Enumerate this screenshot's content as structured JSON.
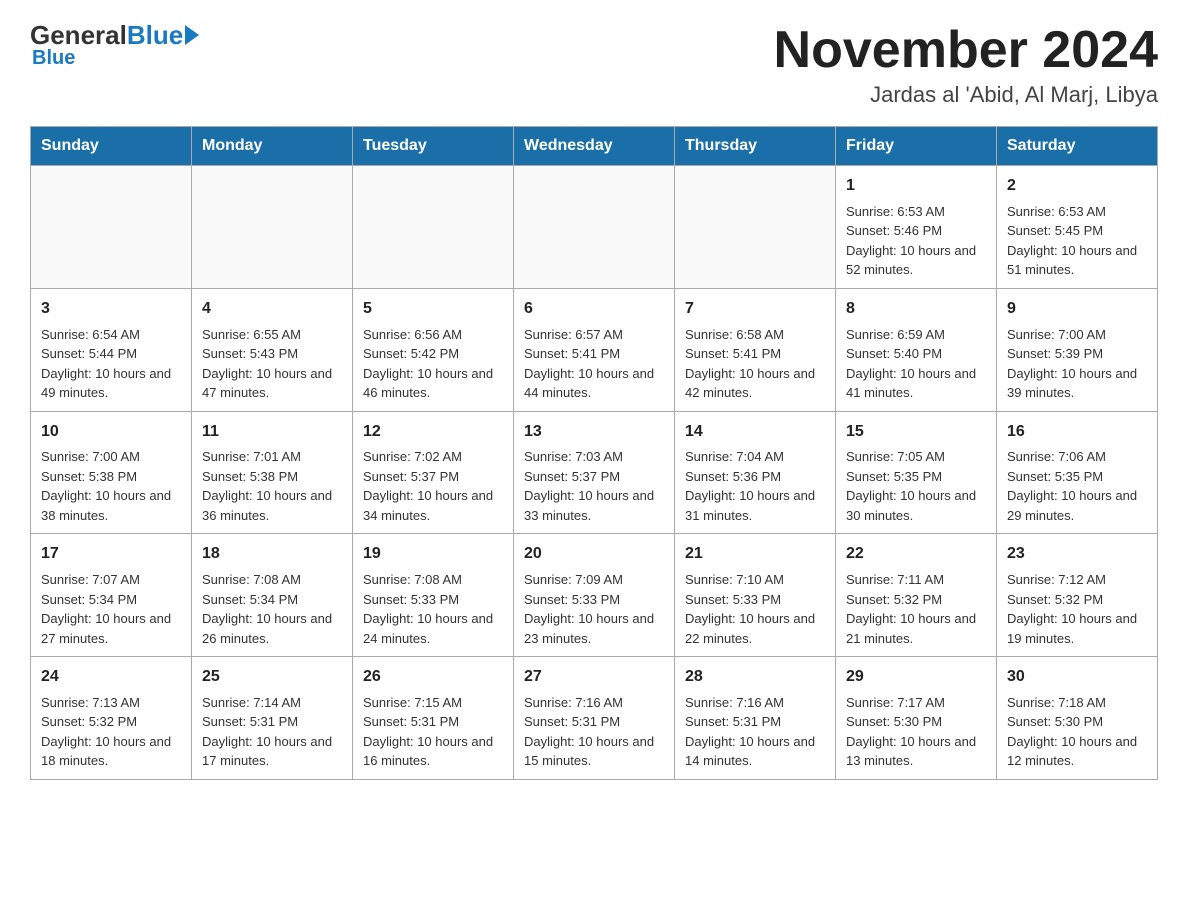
{
  "header": {
    "logo_general": "General",
    "logo_blue": "Blue",
    "month_title": "November 2024",
    "location": "Jardas al 'Abid, Al Marj, Libya"
  },
  "weekdays": [
    "Sunday",
    "Monday",
    "Tuesday",
    "Wednesday",
    "Thursday",
    "Friday",
    "Saturday"
  ],
  "weeks": [
    [
      {
        "day": "",
        "info": ""
      },
      {
        "day": "",
        "info": ""
      },
      {
        "day": "",
        "info": ""
      },
      {
        "day": "",
        "info": ""
      },
      {
        "day": "",
        "info": ""
      },
      {
        "day": "1",
        "info": "Sunrise: 6:53 AM\nSunset: 5:46 PM\nDaylight: 10 hours and 52 minutes."
      },
      {
        "day": "2",
        "info": "Sunrise: 6:53 AM\nSunset: 5:45 PM\nDaylight: 10 hours and 51 minutes."
      }
    ],
    [
      {
        "day": "3",
        "info": "Sunrise: 6:54 AM\nSunset: 5:44 PM\nDaylight: 10 hours and 49 minutes."
      },
      {
        "day": "4",
        "info": "Sunrise: 6:55 AM\nSunset: 5:43 PM\nDaylight: 10 hours and 47 minutes."
      },
      {
        "day": "5",
        "info": "Sunrise: 6:56 AM\nSunset: 5:42 PM\nDaylight: 10 hours and 46 minutes."
      },
      {
        "day": "6",
        "info": "Sunrise: 6:57 AM\nSunset: 5:41 PM\nDaylight: 10 hours and 44 minutes."
      },
      {
        "day": "7",
        "info": "Sunrise: 6:58 AM\nSunset: 5:41 PM\nDaylight: 10 hours and 42 minutes."
      },
      {
        "day": "8",
        "info": "Sunrise: 6:59 AM\nSunset: 5:40 PM\nDaylight: 10 hours and 41 minutes."
      },
      {
        "day": "9",
        "info": "Sunrise: 7:00 AM\nSunset: 5:39 PM\nDaylight: 10 hours and 39 minutes."
      }
    ],
    [
      {
        "day": "10",
        "info": "Sunrise: 7:00 AM\nSunset: 5:38 PM\nDaylight: 10 hours and 38 minutes."
      },
      {
        "day": "11",
        "info": "Sunrise: 7:01 AM\nSunset: 5:38 PM\nDaylight: 10 hours and 36 minutes."
      },
      {
        "day": "12",
        "info": "Sunrise: 7:02 AM\nSunset: 5:37 PM\nDaylight: 10 hours and 34 minutes."
      },
      {
        "day": "13",
        "info": "Sunrise: 7:03 AM\nSunset: 5:37 PM\nDaylight: 10 hours and 33 minutes."
      },
      {
        "day": "14",
        "info": "Sunrise: 7:04 AM\nSunset: 5:36 PM\nDaylight: 10 hours and 31 minutes."
      },
      {
        "day": "15",
        "info": "Sunrise: 7:05 AM\nSunset: 5:35 PM\nDaylight: 10 hours and 30 minutes."
      },
      {
        "day": "16",
        "info": "Sunrise: 7:06 AM\nSunset: 5:35 PM\nDaylight: 10 hours and 29 minutes."
      }
    ],
    [
      {
        "day": "17",
        "info": "Sunrise: 7:07 AM\nSunset: 5:34 PM\nDaylight: 10 hours and 27 minutes."
      },
      {
        "day": "18",
        "info": "Sunrise: 7:08 AM\nSunset: 5:34 PM\nDaylight: 10 hours and 26 minutes."
      },
      {
        "day": "19",
        "info": "Sunrise: 7:08 AM\nSunset: 5:33 PM\nDaylight: 10 hours and 24 minutes."
      },
      {
        "day": "20",
        "info": "Sunrise: 7:09 AM\nSunset: 5:33 PM\nDaylight: 10 hours and 23 minutes."
      },
      {
        "day": "21",
        "info": "Sunrise: 7:10 AM\nSunset: 5:33 PM\nDaylight: 10 hours and 22 minutes."
      },
      {
        "day": "22",
        "info": "Sunrise: 7:11 AM\nSunset: 5:32 PM\nDaylight: 10 hours and 21 minutes."
      },
      {
        "day": "23",
        "info": "Sunrise: 7:12 AM\nSunset: 5:32 PM\nDaylight: 10 hours and 19 minutes."
      }
    ],
    [
      {
        "day": "24",
        "info": "Sunrise: 7:13 AM\nSunset: 5:32 PM\nDaylight: 10 hours and 18 minutes."
      },
      {
        "day": "25",
        "info": "Sunrise: 7:14 AM\nSunset: 5:31 PM\nDaylight: 10 hours and 17 minutes."
      },
      {
        "day": "26",
        "info": "Sunrise: 7:15 AM\nSunset: 5:31 PM\nDaylight: 10 hours and 16 minutes."
      },
      {
        "day": "27",
        "info": "Sunrise: 7:16 AM\nSunset: 5:31 PM\nDaylight: 10 hours and 15 minutes."
      },
      {
        "day": "28",
        "info": "Sunrise: 7:16 AM\nSunset: 5:31 PM\nDaylight: 10 hours and 14 minutes."
      },
      {
        "day": "29",
        "info": "Sunrise: 7:17 AM\nSunset: 5:30 PM\nDaylight: 10 hours and 13 minutes."
      },
      {
        "day": "30",
        "info": "Sunrise: 7:18 AM\nSunset: 5:30 PM\nDaylight: 10 hours and 12 minutes."
      }
    ]
  ]
}
